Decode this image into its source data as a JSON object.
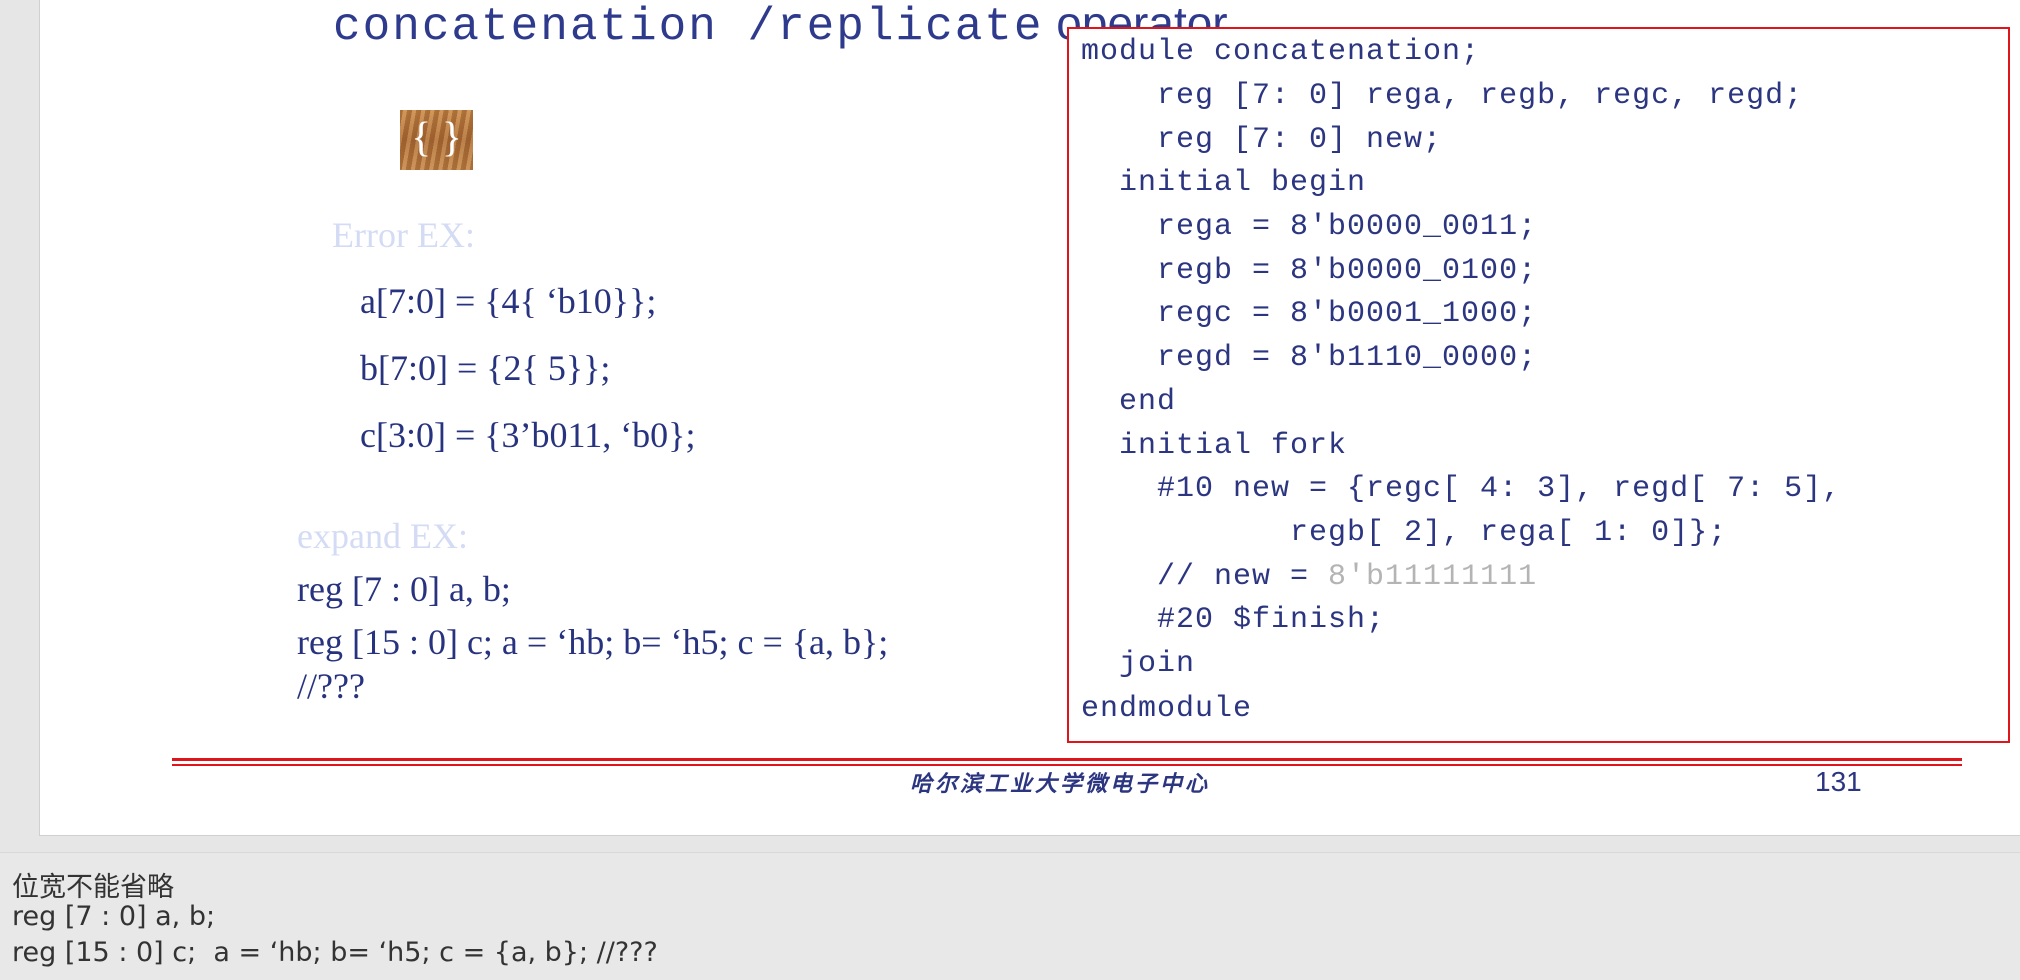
{
  "slide": {
    "title_mono": "concatenation /replicate",
    "title_sans": " operator",
    "brace_icon_text": "{ }",
    "error_label": "Error EX:",
    "error_examples": [
      "a[7:0] = {4{ ‘b10}};",
      "b[7:0] = {2{ 5}};",
      "c[3:0] = {3’b011, ‘b0};"
    ],
    "expand_label": "expand EX:",
    "expand_lines": [
      "reg [7 : 0] a, b;",
      "reg [15 : 0] c;  a = ‘hb; b= ‘h5; c = {a, b};",
      "//???"
    ],
    "code": [
      "module concatenation;",
      "    reg [7: 0] rega, regb, regc, regd;",
      "    reg [7: 0] new;",
      "  initial begin",
      "    rega = 8'b0000_0011;",
      "    regb = 8'b0000_0100;",
      "    regc = 8'b0001_1000;",
      "    regd = 8'b1110_0000;",
      "  end",
      "  initial fork",
      "    #10 new = {regc[ 4: 3], regd[ 7: 5],",
      "           regb[ 2], rega[ 1: 0]};",
      "    #20 $finish;",
      "  join",
      "endmodule"
    ],
    "code_comment": "    // new = ",
    "code_comment_gray": "8'b11111111",
    "footer_org": "哈尔滨工业大学微电子中心",
    "page_number": "131",
    "colors": {
      "accent_red": "#e0141b",
      "text_navy": "#27337f"
    }
  },
  "notes": {
    "lines": [
      "位宽不能省略",
      "reg [7 : 0] a, b;",
      "reg [15 : 0] c;  a = ‘hb; b= ‘h5; c = {a, b}; //???"
    ]
  }
}
